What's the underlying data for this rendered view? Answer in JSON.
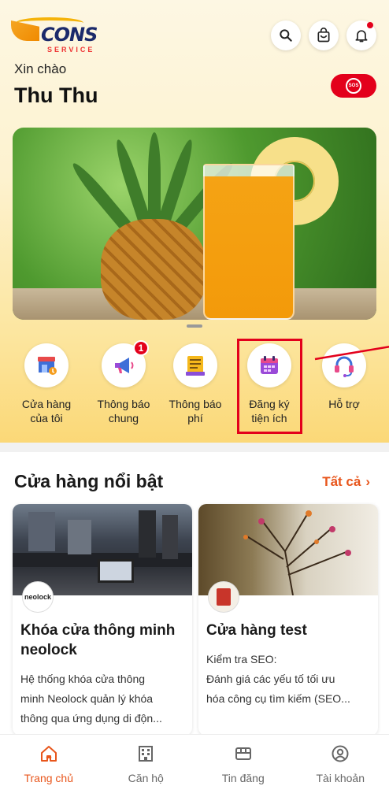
{
  "brand": {
    "name": "CONS",
    "sub": "SERVICE"
  },
  "header": {
    "greeting": "Xin chào",
    "username": "Thu Thu",
    "sos_label": "SOS"
  },
  "menu": {
    "items": [
      {
        "label_line1": "Cửa hàng",
        "label_line2": "của tôi",
        "icon": "store-icon",
        "badge": ""
      },
      {
        "label_line1": "Thông báo",
        "label_line2": "chung",
        "icon": "megaphone-icon",
        "badge": "1"
      },
      {
        "label_line1": "Thông báo",
        "label_line2": "phí",
        "icon": "fee-notice-icon",
        "badge": ""
      },
      {
        "label_line1": "Đăng ký",
        "label_line2": "tiện ích",
        "icon": "calendar-icon",
        "badge": ""
      },
      {
        "label_line1": "Hỗ trợ",
        "label_line2": "",
        "icon": "headset-icon",
        "badge": ""
      }
    ]
  },
  "featured": {
    "title": "Cửa hàng nổi bật",
    "see_all": "Tất cả",
    "stores": [
      {
        "avatar": "neolock",
        "title": "Khóa cửa thông minh neolock",
        "desc_lines": [
          "Hệ thống khóa cửa thông",
          "minh Neolock quản lý khóa",
          "thông qua ứng dụng di độn..."
        ]
      },
      {
        "avatar": "",
        "title": "Cửa hàng test",
        "desc_lines": [
          "Kiểm tra SEO:",
          "Đánh giá các yếu tố tối ưu",
          "hóa công cụ tìm kiếm (SEO..."
        ]
      }
    ]
  },
  "bottom_nav": [
    {
      "label": "Trang chủ",
      "icon": "home-icon",
      "active": true
    },
    {
      "label": "Căn hộ",
      "icon": "building-icon",
      "active": false
    },
    {
      "label": "Tin đăng",
      "icon": "listing-icon",
      "active": false
    },
    {
      "label": "Tài khoản",
      "icon": "account-icon",
      "active": false
    }
  ],
  "colors": {
    "accent": "#e8561c",
    "alert": "#e3001b",
    "brand_navy": "#1b2a6b"
  }
}
